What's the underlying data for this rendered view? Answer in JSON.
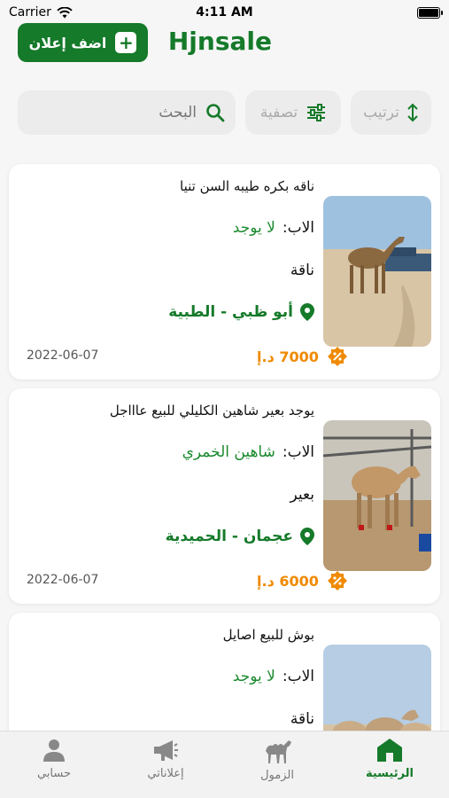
{
  "status_bar": {
    "carrier": "Carrier",
    "time": "4:11 AM"
  },
  "header": {
    "title": "Hjnsale",
    "add_ad_label": "اضف إعلان"
  },
  "toolbar": {
    "search_placeholder": "البحث",
    "filter_label": "تصفية",
    "sort_label": "ترتيب"
  },
  "listings": [
    {
      "title": "ناقه بكره طيبه السن تنيا",
      "father_label": "الاب:",
      "father_value": "لا يوجد",
      "type": "ناقة",
      "location": "أبو ظبي - الطبية",
      "price": "7000 د.إ",
      "date": "2022-06-07"
    },
    {
      "title": "يوجد بعير شاهين الكليلي للبيع عاااجل",
      "father_label": "الاب:",
      "father_value": "شاهين الخمري",
      "type": "بعير",
      "location": "عجمان - الحميدية",
      "price": "6000 د.إ",
      "date": "2022-06-07"
    },
    {
      "title": "بوش للبيع اصايل",
      "father_label": "الاب:",
      "father_value": "لا يوجد",
      "type": "ناقة"
    }
  ],
  "tabs": [
    {
      "label": "الرئيسية",
      "icon": "home-icon",
      "active": true
    },
    {
      "label": "الزمول",
      "icon": "camel-icon",
      "active": false
    },
    {
      "label": "إعلاناتي",
      "icon": "megaphone-icon",
      "active": false
    },
    {
      "label": "حسابي",
      "icon": "person-icon",
      "active": false
    }
  ],
  "colors": {
    "brand": "#157a2a",
    "price": "#f08a00",
    "father_value": "#1a8a2e"
  }
}
